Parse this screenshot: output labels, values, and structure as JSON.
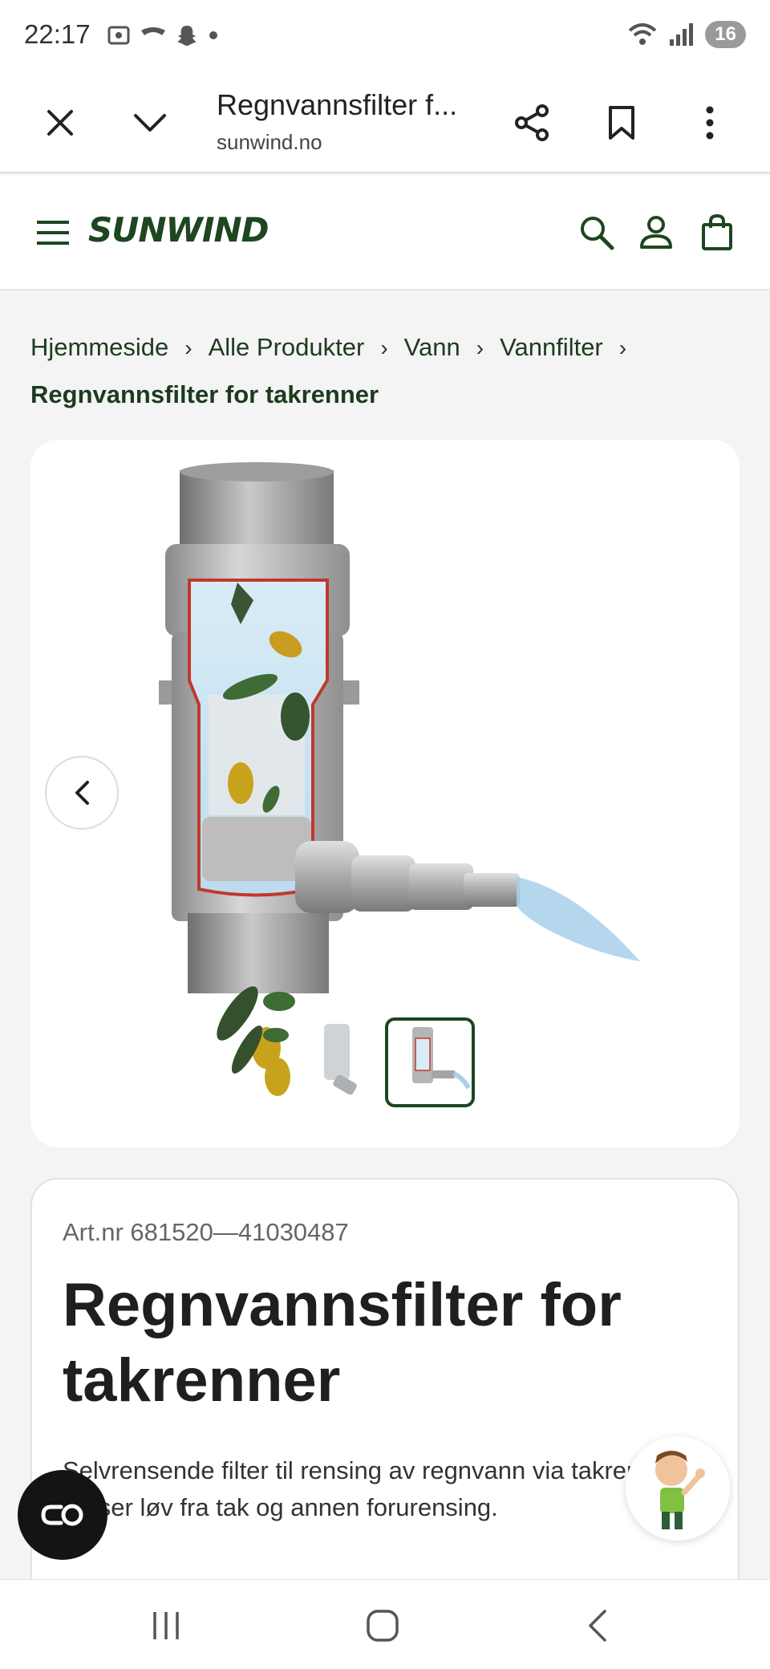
{
  "status_bar": {
    "time": "22:17",
    "battery": "16",
    "icons": [
      "screenshot-icon",
      "tripadvisor-icon",
      "snapchat-icon",
      "dot-icon",
      "wifi-icon",
      "signal-icon",
      "battery-icon"
    ]
  },
  "browser": {
    "title": "Regnvannsfilter f...",
    "url": "sunwind.no",
    "buttons": [
      "close-icon",
      "chevron-down-icon",
      "share-icon",
      "bookmark-icon",
      "more-vert-icon"
    ]
  },
  "site_header": {
    "logo": "SUNWIND",
    "icons": [
      "menu-icon",
      "search-icon",
      "account-icon",
      "cart-icon"
    ]
  },
  "breadcrumb": {
    "items": [
      "Hjemmeside",
      "Alle Produkter",
      "Vann",
      "Vannfilter"
    ],
    "separator": "›",
    "current": "Regnvannsfilter for takrenner"
  },
  "gallery": {
    "active_thumbnail_index": 2,
    "thumbnail_count": 3
  },
  "product": {
    "art_nr": "Art.nr 681520—41030487",
    "title": "Regnvannsfilter for takrenner",
    "description": "Selvrensende filter til rensing av regnvann via takrenner, renser løv fra tak og annen forurensing."
  },
  "colors": {
    "brand_dark": "#1e4620",
    "brand_light": "#6cb33f",
    "page_bg": "#f4f4f4"
  }
}
